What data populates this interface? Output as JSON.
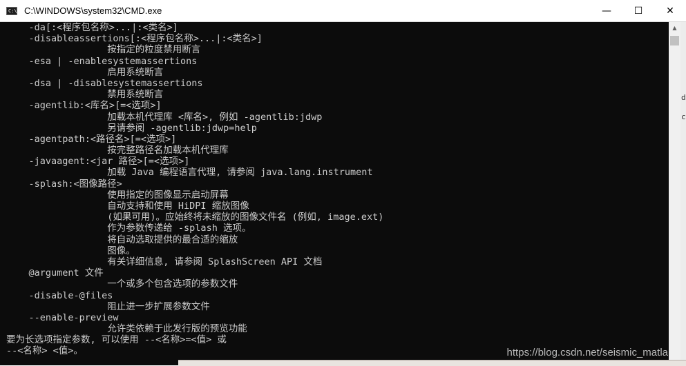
{
  "window": {
    "title": "C:\\WINDOWS\\system32\\CMD.exe",
    "icon_label": "C:\\",
    "controls": {
      "minimize": "—",
      "maximize": "☐",
      "close": "✕"
    }
  },
  "console": {
    "lines": [
      "    -da[:<程序包名称>...|:<类名>]",
      "    -disableassertions[:<程序包名称>...|:<类名>]",
      "                  按指定的粒度禁用断言",
      "    -esa | -enablesystemassertions",
      "                  启用系统断言",
      "    -dsa | -disablesystemassertions",
      "                  禁用系统断言",
      "    -agentlib:<库名>[=<选项>]",
      "                  加载本机代理库 <库名>, 例如 -agentlib:jdwp",
      "                  另请参阅 -agentlib:jdwp=help",
      "    -agentpath:<路径名>[=<选项>]",
      "                  按完整路径名加载本机代理库",
      "    -javaagent:<jar 路径>[=<选项>]",
      "                  加载 Java 编程语言代理, 请参阅 java.lang.instrument",
      "    -splash:<图像路径>",
      "                  使用指定的图像显示启动屏幕",
      "                  自动支持和使用 HiDPI 缩放图像",
      "                  (如果可用)。应始终将未缩放的图像文件名 (例如, image.ext)",
      "                  作为参数传递给 -splash 选项。",
      "                  将自动选取提供的最合适的缩放",
      "                  图像。",
      "                  有关详细信息, 请参阅 SplashScreen API 文档",
      "    @argument 文件",
      "                  一个或多个包含选项的参数文件",
      "    -disable-@files",
      "                  阻止进一步扩展参数文件",
      "    --enable-preview",
      "                  允许类依赖于此发行版的预览功能",
      "要为长选项指定参数, 可以使用 --<名称>=<值> 或",
      "--<名称> <值>。"
    ]
  },
  "scrollbar": {
    "up_arrow": "▲"
  },
  "right_edge_glyphs": [
    "d",
    "c"
  ],
  "watermark": "https://blog.csdn.net/seismic_matla"
}
